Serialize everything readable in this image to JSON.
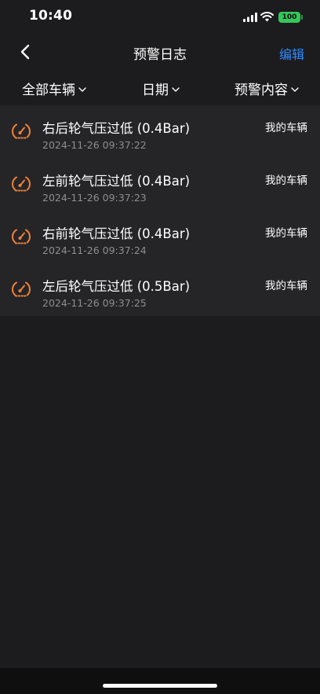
{
  "status_bar": {
    "time": "10:40",
    "battery": "100",
    "signal_icon": "cellular-signal-icon",
    "wifi_icon": "wifi-icon"
  },
  "nav": {
    "back_icon": "chevron-left-icon",
    "title": "预警日志",
    "edit_label": "编辑"
  },
  "filters": {
    "vehicle": "全部车辆",
    "date": "日期",
    "content": "预警内容"
  },
  "alerts": [
    {
      "title": "右后轮气压过低 (0.4Bar)",
      "time": "2024-11-26 09:37:22",
      "vehicle": "我的车辆",
      "icon": "tire-pressure-warning-icon"
    },
    {
      "title": "左前轮气压过低 (0.4Bar)",
      "time": "2024-11-26 09:37:23",
      "vehicle": "我的车辆",
      "icon": "tire-pressure-warning-icon"
    },
    {
      "title": "右前轮气压过低 (0.4Bar)",
      "time": "2024-11-26 09:37:24",
      "vehicle": "我的车辆",
      "icon": "tire-pressure-warning-icon"
    },
    {
      "title": "左后轮气压过低 (0.5Bar)",
      "time": "2024-11-26 09:37:25",
      "vehicle": "我的车辆",
      "icon": "tire-pressure-warning-icon"
    }
  ],
  "colors": {
    "background": "#1c1c1e",
    "list_background": "#252527",
    "accent": "#2f8bff",
    "warning_icon": "#f0813a",
    "battery": "#34c759"
  }
}
